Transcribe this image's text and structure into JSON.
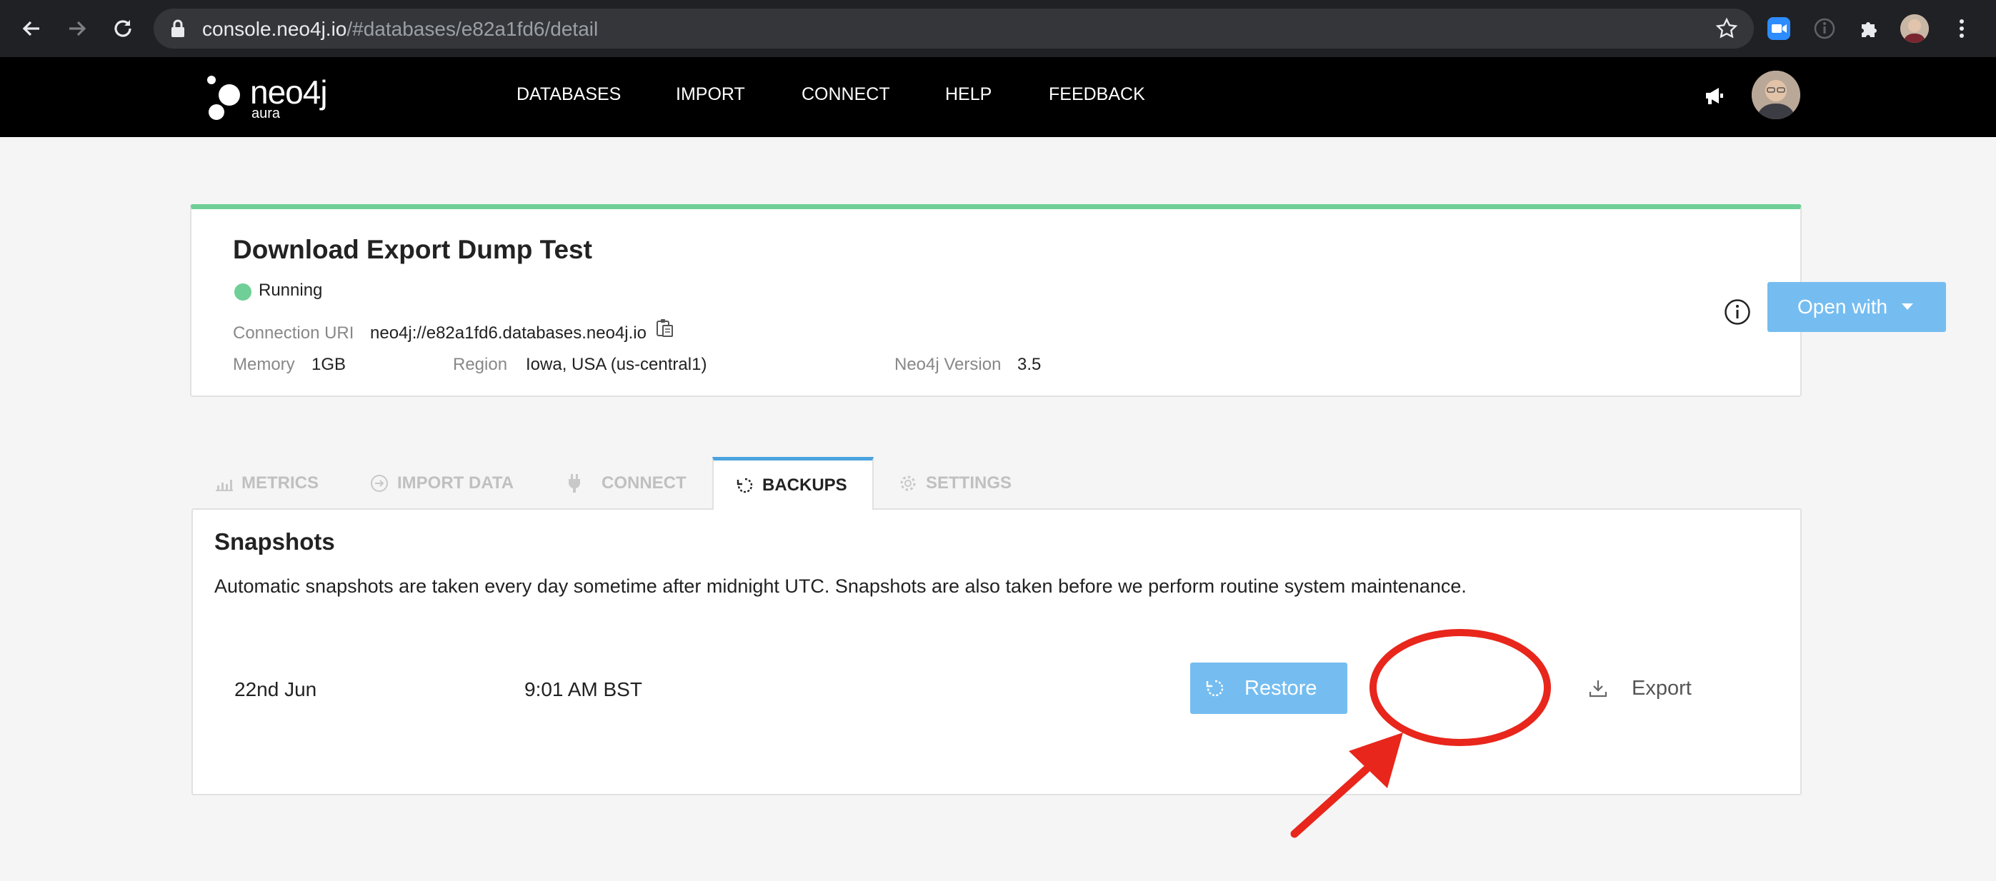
{
  "browser": {
    "url_host": "console.neo4j.io",
    "url_path": "/#databases/e82a1fd6/detail"
  },
  "header": {
    "logo_text": "neo4j",
    "logo_sub": "aura",
    "nav": [
      "DATABASES",
      "IMPORT",
      "CONNECT",
      "HELP",
      "FEEDBACK"
    ]
  },
  "database": {
    "title": "Download Export Dump Test",
    "status": "Running",
    "connection_uri_label": "Connection URI",
    "connection_uri": "neo4j://e82a1fd6.databases.neo4j.io",
    "memory_label": "Memory",
    "memory": "1GB",
    "region_label": "Region",
    "region": "Iowa, USA (us-central1)",
    "version_label": "Neo4j Version",
    "version": "3.5",
    "open_with_label": "Open with"
  },
  "tabs": [
    {
      "label": "METRICS",
      "icon": "bar-chart-icon"
    },
    {
      "label": "IMPORT DATA",
      "icon": "import-icon"
    },
    {
      "label": "CONNECT",
      "icon": "plug-icon"
    },
    {
      "label": "BACKUPS",
      "icon": "backup-icon"
    },
    {
      "label": "SETTINGS",
      "icon": "gear-icon"
    }
  ],
  "backups": {
    "title": "Snapshots",
    "description": "Automatic snapshots are taken every day sometime after midnight UTC. Snapshots are also taken before we perform routine system maintenance.",
    "snapshot": {
      "date": "22nd Jun",
      "time": "9:01 AM BST",
      "restore_label": "Restore",
      "export_label": "Export"
    }
  },
  "colors": {
    "accent": "#75bdf0",
    "status_running": "#6fcf97",
    "annotation": "#e8261c"
  }
}
